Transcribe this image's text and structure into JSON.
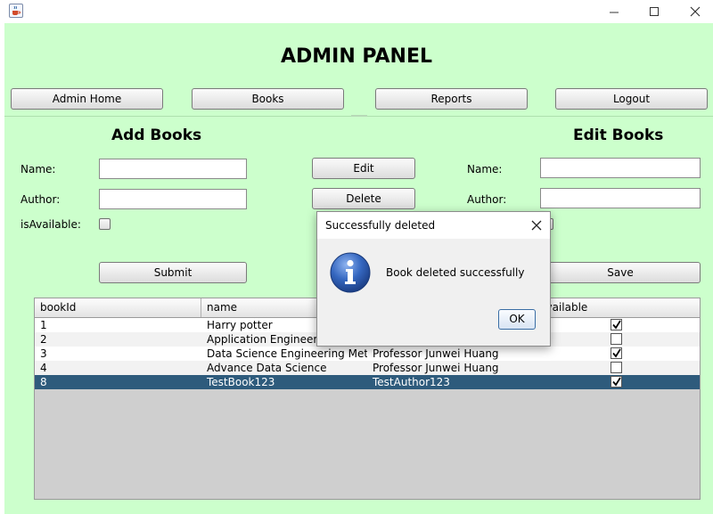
{
  "window": {
    "app_icon": "java-cup-icon"
  },
  "title": "ADMIN PANEL",
  "nav": {
    "admin_home": "Admin Home",
    "books": "Books",
    "reports": "Reports",
    "logout": "Logout"
  },
  "add_books": {
    "title": "Add Books",
    "name_label": "Name:",
    "author_label": "Author:",
    "available_label": "isAvailable:",
    "name_value": "",
    "author_value": "",
    "submit": "Submit"
  },
  "middle": {
    "edit": "Edit",
    "delete": "Delete"
  },
  "edit_books": {
    "title": "Edit Books",
    "name_label": "Name:",
    "author_label": "Author:",
    "name_value": "",
    "author_value": "",
    "save": "Save"
  },
  "table": {
    "columns": [
      "bookId",
      "name",
      "",
      "Available"
    ],
    "rows": [
      {
        "id": "1",
        "name": "Harry potter",
        "author": "",
        "available": true,
        "selected": false
      },
      {
        "id": "2",
        "name": "Application Engineering",
        "author": "",
        "available": false,
        "selected": false
      },
      {
        "id": "3",
        "name": "Data Science Engineering Met...",
        "author": "Professor Junwei Huang",
        "available": true,
        "selected": false
      },
      {
        "id": "4",
        "name": "Advance Data Science",
        "author": "Professor Junwei Huang",
        "available": false,
        "selected": false
      },
      {
        "id": "8",
        "name": "TestBook123",
        "author": "TestAuthor123",
        "available": true,
        "selected": true
      }
    ]
  },
  "dialog": {
    "title": "Successfully deleted",
    "message": "Book deleted successfully",
    "ok": "OK"
  },
  "colors": {
    "panel_bg": "#ccffcc",
    "selected_row": "#2e5b7c",
    "info_blue": "#2d5fb3"
  }
}
